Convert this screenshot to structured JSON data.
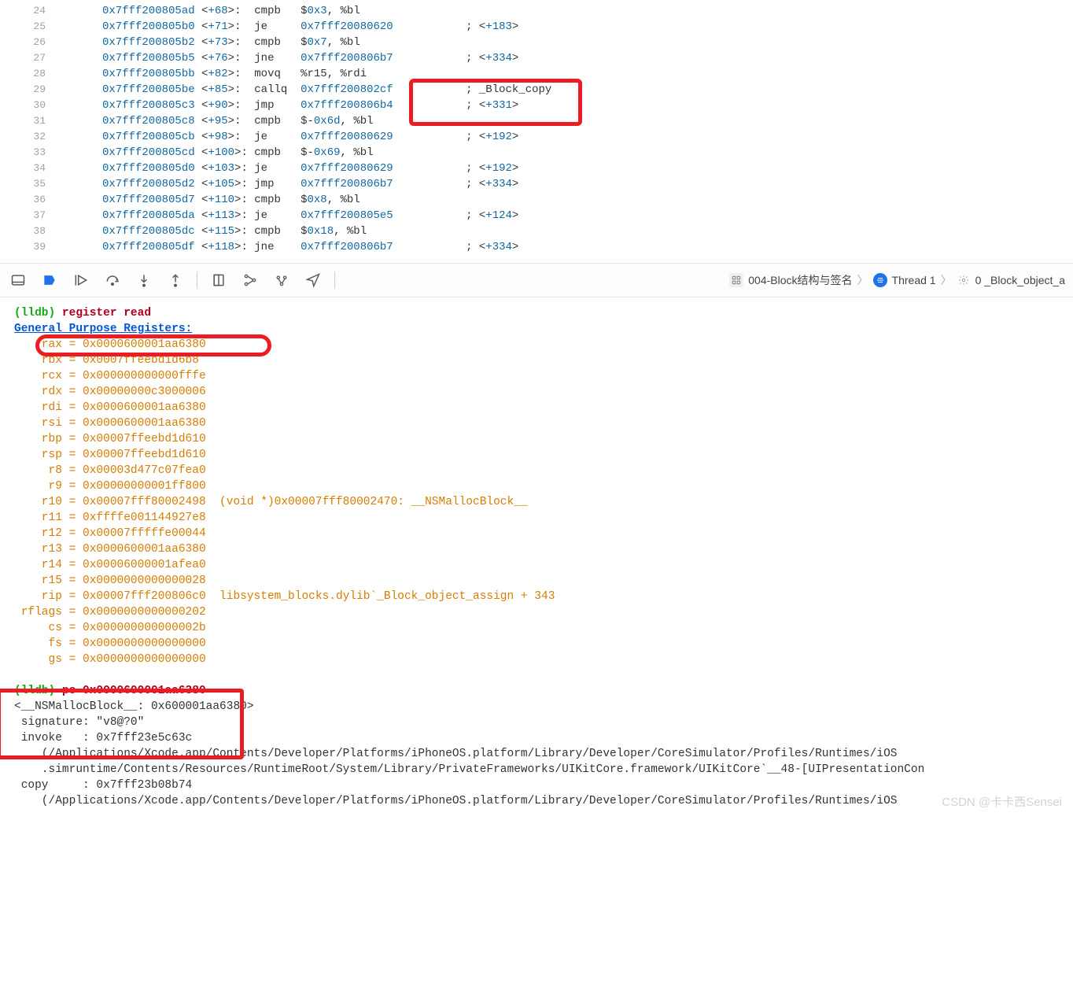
{
  "asm": [
    {
      "ln": "24",
      "addr": "0x7fff200805ad",
      "off": "+68",
      "mn": "cmpb",
      "op": "$0x3, %bl",
      "cmt": ""
    },
    {
      "ln": "25",
      "addr": "0x7fff200805b0",
      "off": "+71",
      "mn": "je",
      "op": "0x7fff20080620",
      "cmt": "; <+183>"
    },
    {
      "ln": "26",
      "addr": "0x7fff200805b2",
      "off": "+73",
      "mn": "cmpb",
      "op": "$0x7, %bl",
      "cmt": ""
    },
    {
      "ln": "27",
      "addr": "0x7fff200805b5",
      "off": "+76",
      "mn": "jne",
      "op": "0x7fff200806b7",
      "cmt": "; <+334>"
    },
    {
      "ln": "28",
      "addr": "0x7fff200805bb",
      "off": "+82",
      "mn": "movq",
      "op": "%r15, %rdi",
      "cmt": ""
    },
    {
      "ln": "29",
      "addr": "0x7fff200805be",
      "off": "+85",
      "mn": "callq",
      "op": "0x7fff200802cf",
      "cmt": "; _Block_copy"
    },
    {
      "ln": "30",
      "addr": "0x7fff200805c3",
      "off": "+90",
      "mn": "jmp",
      "op": "0x7fff200806b4",
      "cmt": "; <+331>"
    },
    {
      "ln": "31",
      "addr": "0x7fff200805c8",
      "off": "+95",
      "mn": "cmpb",
      "op": "$-0x6d, %bl",
      "cmt": ""
    },
    {
      "ln": "32",
      "addr": "0x7fff200805cb",
      "off": "+98",
      "mn": "je",
      "op": "0x7fff20080629",
      "cmt": "; <+192>"
    },
    {
      "ln": "33",
      "addr": "0x7fff200805cd",
      "off": "+100",
      "mn": "cmpb",
      "op": "$-0x69, %bl",
      "cmt": ""
    },
    {
      "ln": "34",
      "addr": "0x7fff200805d0",
      "off": "+103",
      "mn": "je",
      "op": "0x7fff20080629",
      "cmt": "; <+192>"
    },
    {
      "ln": "35",
      "addr": "0x7fff200805d2",
      "off": "+105",
      "mn": "jmp",
      "op": "0x7fff200806b7",
      "cmt": "; <+334>"
    },
    {
      "ln": "36",
      "addr": "0x7fff200805d7",
      "off": "+110",
      "mn": "cmpb",
      "op": "$0x8, %bl",
      "cmt": ""
    },
    {
      "ln": "37",
      "addr": "0x7fff200805da",
      "off": "+113",
      "mn": "je",
      "op": "0x7fff200805e5",
      "cmt": "; <+124>"
    },
    {
      "ln": "38",
      "addr": "0x7fff200805dc",
      "off": "+115",
      "mn": "cmpb",
      "op": "$0x18, %bl",
      "cmt": ""
    },
    {
      "ln": "39",
      "addr": "0x7fff200805df",
      "off": "+118",
      "mn": "jne",
      "op": "0x7fff200806b7",
      "cmt": "; <+334>"
    }
  ],
  "breadcrumb": {
    "project": "004-Block结构与签名",
    "thread": "Thread 1",
    "frame": "0 _Block_object_a"
  },
  "console": {
    "prompt": "(lldb)",
    "cmd1": "register read",
    "header": "General Purpose Registers:",
    "regs": [
      {
        "n": "rax",
        "v": "0x0000600001aa6380",
        "note": ""
      },
      {
        "n": "rbx",
        "v": "0x0007ffeebd1d6b8",
        "note": ""
      },
      {
        "n": "rcx",
        "v": "0x000000000000fffe",
        "note": ""
      },
      {
        "n": "rdx",
        "v": "0x00000000c3000006",
        "note": ""
      },
      {
        "n": "rdi",
        "v": "0x0000600001aa6380",
        "note": ""
      },
      {
        "n": "rsi",
        "v": "0x0000600001aa6380",
        "note": ""
      },
      {
        "n": "rbp",
        "v": "0x00007ffeebd1d610",
        "note": ""
      },
      {
        "n": "rsp",
        "v": "0x00007ffeebd1d610",
        "note": ""
      },
      {
        "n": "r8",
        "v": "0x00003d477c07fea0",
        "note": ""
      },
      {
        "n": "r9",
        "v": "0x00000000001ff800",
        "note": ""
      },
      {
        "n": "r10",
        "v": "0x00007fff80002498",
        "note": "  (void *)0x00007fff80002470: __NSMallocBlock__"
      },
      {
        "n": "r11",
        "v": "0xffffe001144927e8",
        "note": ""
      },
      {
        "n": "r12",
        "v": "0x00007fffffe00044",
        "note": ""
      },
      {
        "n": "r13",
        "v": "0x0000600001aa6380",
        "note": ""
      },
      {
        "n": "r14",
        "v": "0x00006000001afea0",
        "note": ""
      },
      {
        "n": "r15",
        "v": "0x0000000000000028",
        "note": ""
      },
      {
        "n": "rip",
        "v": "0x00007fff200806c0",
        "note": "  libsystem_blocks.dylib`_Block_object_assign + 343"
      },
      {
        "n": "rflags",
        "v": "0x0000000000000202",
        "note": ""
      },
      {
        "n": "cs",
        "v": "0x000000000000002b",
        "note": ""
      },
      {
        "n": "fs",
        "v": "0x0000000000000000",
        "note": ""
      },
      {
        "n": "gs",
        "v": "0x0000000000000000",
        "note": ""
      }
    ],
    "cmd2": "po 0x0000600001aa6380",
    "po_out": [
      "<__NSMallocBlock__: 0x600001aa6380>",
      " signature: \"v8@?0\"",
      " invoke   : 0x7fff23e5c63c",
      "    (/Applications/Xcode.app/Contents/Developer/Platforms/iPhoneOS.platform/Library/Developer/CoreSimulator/Profiles/Runtimes/iOS",
      "    .simruntime/Contents/Resources/RuntimeRoot/System/Library/PrivateFrameworks/UIKitCore.framework/UIKitCore`__48-[UIPresentationCon",
      " copy     : 0x7fff23b08b74",
      "    (/Applications/Xcode.app/Contents/Developer/Platforms/iPhoneOS.platform/Library/Developer/CoreSimulator/Profiles/Runtimes/iOS"
    ]
  },
  "watermark": "CSDN @卡卡西Sensei"
}
